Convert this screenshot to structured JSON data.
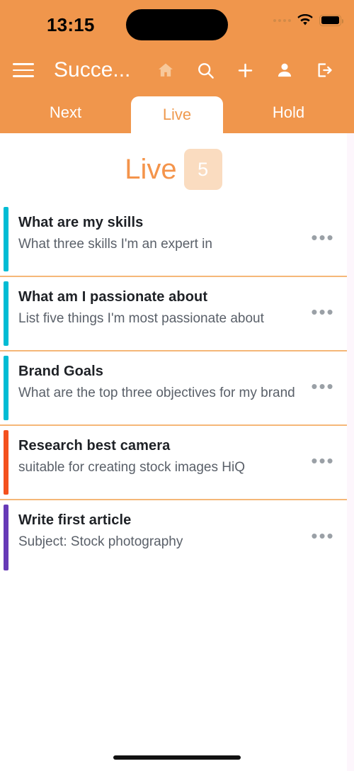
{
  "status_bar": {
    "time": "13:15",
    "signal_icon": "signal-dots-icon",
    "wifi_icon": "wifi-icon",
    "battery_icon": "battery-icon"
  },
  "app_bar": {
    "menu_icon": "hamburger-menu-icon",
    "title": "Succe...",
    "actions": [
      {
        "name": "home-icon",
        "label": "Home"
      },
      {
        "name": "search-icon",
        "label": "Search"
      },
      {
        "name": "plus-icon",
        "label": "Add"
      },
      {
        "name": "person-icon",
        "label": "Account"
      },
      {
        "name": "logout-icon",
        "label": "Log out"
      }
    ]
  },
  "tabs": [
    {
      "label": "Next",
      "active": false
    },
    {
      "label": "Live",
      "active": true
    },
    {
      "label": "Hold",
      "active": false
    }
  ],
  "page_head": {
    "title": "Live",
    "count": "5"
  },
  "list_items": [
    {
      "title": "What are my skills",
      "subtitle": "What three skills I'm an expert in",
      "bar_color": "#00bcd4",
      "menu": "•••"
    },
    {
      "title": "What am I passionate about",
      "subtitle": "List five things I'm most passionate about",
      "bar_color": "#00bcd4",
      "menu": "•••"
    },
    {
      "title": "Brand Goals",
      "subtitle": "What are the top three objectives for my brand",
      "bar_color": "#00bcd4",
      "menu": "•••"
    },
    {
      "title": "Research best camera",
      "subtitle": "suitable for creating stock images HiQ",
      "bar_color": "#f4511e",
      "menu": "•••"
    },
    {
      "title": "Write first article",
      "subtitle": "Subject: Stock photography",
      "bar_color": "#673ab7",
      "menu": "•••"
    }
  ],
  "colors": {
    "header_orange": "#f0964c",
    "accent_orange": "#f4944b",
    "badge_bg": "#fadcc0",
    "divider": "#f5b778",
    "page_bg": "#fdf6fc",
    "cyan": "#00bcd4",
    "deep_orange": "#f4511e",
    "purple": "#673ab7"
  }
}
